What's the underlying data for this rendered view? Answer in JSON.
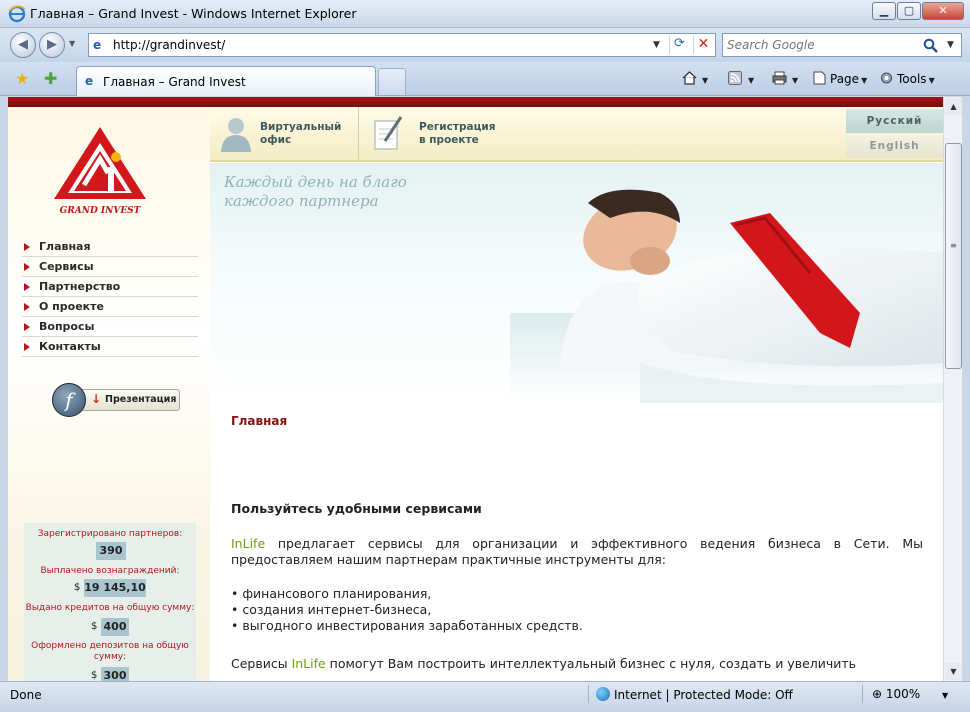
{
  "window": {
    "title": "Главная – Grand Invest - Windows Internet Explorer",
    "min_glyph": "▁",
    "max_glyph": "▢",
    "close_glyph": "✕"
  },
  "navbar": {
    "url": "http://grandinvest/",
    "search_placeholder": "Search Google"
  },
  "tabs": [
    {
      "label": "Главная – Grand Invest"
    }
  ],
  "commands": {
    "page": "Page",
    "tools": "Tools"
  },
  "site": {
    "logo_text": "GRAND INVEST",
    "menu": [
      {
        "label": "Главная"
      },
      {
        "label": "Сервисы"
      },
      {
        "label": "Партнерство"
      },
      {
        "label": "О проекте"
      },
      {
        "label": "Вопросы"
      },
      {
        "label": "Контакты"
      }
    ],
    "presentation_label": "Презентация",
    "top_nav": [
      {
        "line1": "Виртуальный",
        "line2": "офис"
      },
      {
        "line1": "Регистрация",
        "line2": "в проекте"
      }
    ],
    "lang_ru": "Русский",
    "lang_en": "English",
    "slogan_line1": "Каждый день на благо",
    "slogan_line2": "каждого партнера",
    "stats": {
      "partners_label": "Зарегистрировано партнеров:",
      "partners_value": "390",
      "rewards_label": "Выплачено вознаграждений:",
      "rewards_value": "19 145,10",
      "credits_label": "Выдано кредитов на общую сумму:",
      "credits_value": "400",
      "deposits_label_1": "Оформлено депозитов на общую",
      "deposits_label_2": "сумму:",
      "deposits_value": "300",
      "currency": "$"
    },
    "breadcrumb": "Главная",
    "heading": "Пользуйтесь удобными сервисами",
    "brand": "InLife",
    "para1_rest": " предлагает сервисы для организации и эффективного ведения бизнеса в Сети. Мы предоставляем нашим партнерам практичные инструменты для:",
    "bullets": [
      "• финансового планирования,",
      "• создания интернет-бизнеса,",
      "• выгодного инвестирования заработанных средств."
    ],
    "para2_start": "Сервисы ",
    "para2_rest": " помогут Вам построить интеллектуальный бизнес с нуля, создать и увеличить"
  },
  "status": {
    "text": "Done",
    "zone": "Internet | Protected Mode: Off",
    "zoom": "100%"
  }
}
